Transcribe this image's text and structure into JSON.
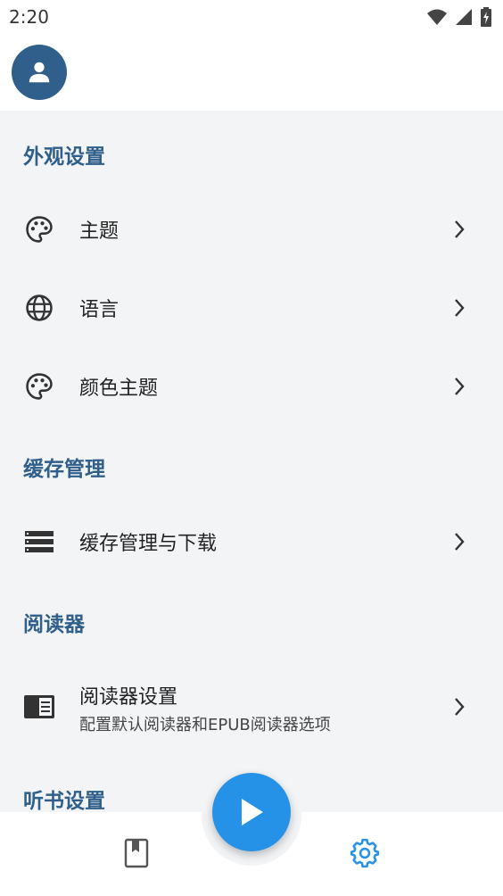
{
  "status_bar": {
    "time": "2:20",
    "icons": [
      "wifi-icon",
      "signal-icon",
      "battery-charging-icon"
    ]
  },
  "header": {
    "avatar_icon": "person-icon"
  },
  "sections": [
    {
      "title": "外观设置",
      "items": [
        {
          "label": "主题",
          "icon": "palette-icon"
        },
        {
          "label": "语言",
          "icon": "globe-icon"
        },
        {
          "label": "颜色主题",
          "icon": "palette-icon"
        }
      ]
    },
    {
      "title": "缓存管理",
      "items": [
        {
          "label": "缓存管理与下载",
          "icon": "storage-icon"
        }
      ]
    },
    {
      "title": "阅读器",
      "items": [
        {
          "label": "阅读器设置",
          "sublabel": "配置默认阅读器和EPUB阅读器选项",
          "icon": "reader-icon"
        }
      ]
    },
    {
      "title": "听书设置",
      "items": []
    }
  ],
  "bottom_nav": {
    "items": [
      {
        "icon": "bookmark-book-icon",
        "active": false
      },
      {
        "icon": "settings-gear-icon",
        "active": true
      }
    ],
    "fab_icon": "play-icon"
  },
  "colors": {
    "accent": "#2f5f8a",
    "fab": "#2592e8",
    "active_nav": "#2592e8",
    "background": "#f3f4f6"
  }
}
